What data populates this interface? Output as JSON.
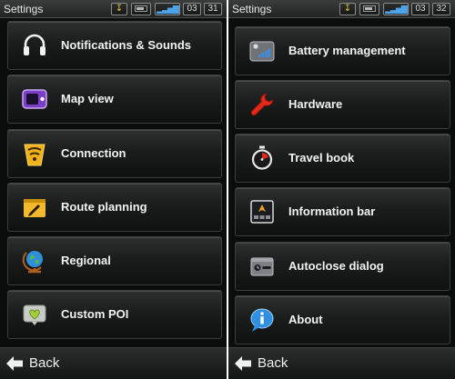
{
  "left": {
    "status": {
      "title": "Settings",
      "hour": "03",
      "minute": "31"
    },
    "items": [
      {
        "label": "Notifications & Sounds",
        "icon": "headphones-icon"
      },
      {
        "label": "Map view",
        "icon": "map-view-icon"
      },
      {
        "label": "Connection",
        "icon": "connection-icon"
      },
      {
        "label": "Route planning",
        "icon": "route-planning-icon"
      },
      {
        "label": "Regional",
        "icon": "globe-icon"
      },
      {
        "label": "Custom POI",
        "icon": "heart-poi-icon"
      }
    ],
    "back_label": "Back"
  },
  "right": {
    "status": {
      "title": "Settings",
      "hour": "03",
      "minute": "32"
    },
    "items": [
      {
        "label": "Battery management",
        "icon": "battery-management-icon"
      },
      {
        "label": "Hardware",
        "icon": "wrench-icon"
      },
      {
        "label": "Travel book",
        "icon": "stopwatch-icon"
      },
      {
        "label": "Information bar",
        "icon": "information-bar-icon"
      },
      {
        "label": "Autoclose dialog",
        "icon": "autoclose-dialog-icon"
      },
      {
        "label": "About",
        "icon": "info-bubble-icon"
      }
    ],
    "back_label": "Back"
  },
  "colors": {
    "accent_blue": "#4ea3e8",
    "accent_yellow": "#e9c434",
    "panel_bg": "#0b0d0c"
  }
}
